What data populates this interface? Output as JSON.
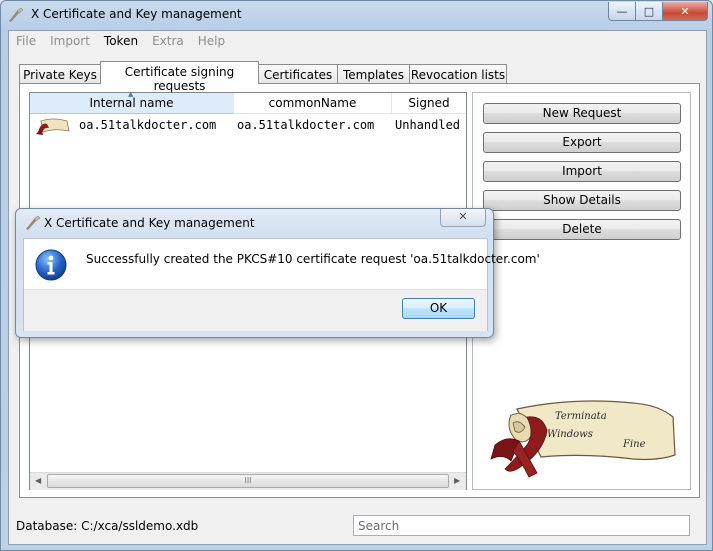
{
  "window": {
    "title": "X Certificate and Key management"
  },
  "menu": [
    "File",
    "Import",
    "Token",
    "Extra",
    "Help"
  ],
  "tabs": [
    "Private Keys",
    "Certificate signing requests",
    "Certificates",
    "Templates",
    "Revocation lists"
  ],
  "table": {
    "columns": [
      "Internal name",
      "commonName",
      "Signed"
    ],
    "rows": [
      {
        "internal_name": "oa.51talkdocter.com",
        "common_name": "oa.51talkdocter.com",
        "signed": "Unhandled"
      }
    ]
  },
  "buttons": {
    "new_request": "New Request",
    "export": "Export",
    "import": "Import",
    "show_details": "Show Details",
    "delete": "Delete"
  },
  "scroll_glyph": "III",
  "logo_text": {
    "line1": "Terminata",
    "line2": "Windows",
    "line3": "Fine"
  },
  "status": {
    "database": "Database: C:/xca/ssldemo.xdb"
  },
  "search": {
    "placeholder": "Search",
    "value": ""
  },
  "dialog": {
    "title": "X Certificate and Key management",
    "message": "Successfully created the PKCS#10 certificate request 'oa.51talkdocter.com'",
    "ok": "OK"
  }
}
